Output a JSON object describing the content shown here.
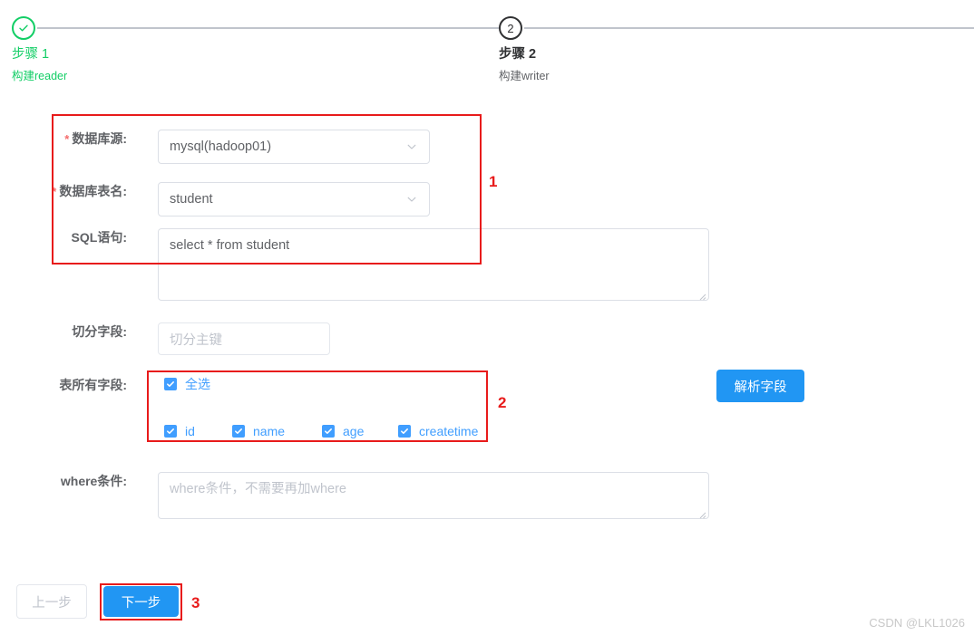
{
  "steps": {
    "items": [
      {
        "index": "1",
        "title": "步骤 1",
        "desc": "构建reader",
        "state": "done",
        "icon": "check-circle-icon"
      },
      {
        "index": "2",
        "title": "步骤 2",
        "desc": "构建writer",
        "state": "current",
        "icon": "number-circle-icon"
      }
    ]
  },
  "form": {
    "datasource": {
      "label": "数据库源:",
      "required": true,
      "value": "mysql(hadoop01)",
      "icon": "chevron-down-icon"
    },
    "table": {
      "label": "数据库表名:",
      "required": true,
      "value": "student",
      "icon": "chevron-down-icon"
    },
    "sql": {
      "label": "SQL语句:",
      "value": "select * from student",
      "placeholder": ""
    },
    "parse_button": "解析字段",
    "split_field": {
      "label": "切分字段:",
      "value": "",
      "placeholder": "切分主键"
    },
    "all_fields": {
      "label": "表所有字段:",
      "select_all": {
        "label": "全选",
        "checked": true
      },
      "fields": [
        {
          "label": "id",
          "checked": true
        },
        {
          "label": "name",
          "checked": true
        },
        {
          "label": "age",
          "checked": true
        },
        {
          "label": "createtime",
          "checked": true
        }
      ]
    },
    "where": {
      "label": "where条件:",
      "value": "",
      "placeholder": "where条件，不需要再加where"
    }
  },
  "footer": {
    "prev_label": "上一步",
    "next_label": "下一步"
  },
  "annotations": [
    {
      "number": "1"
    },
    {
      "number": "2"
    },
    {
      "number": "3"
    }
  ],
  "watermark": "CSDN @LKL1026",
  "colors": {
    "primary": "#2196f3",
    "checkbox": "#409eff",
    "success": "#13ce66",
    "annotation": "#e81b1b",
    "border": "#dcdfe6",
    "placeholder": "#c0c4cc"
  }
}
